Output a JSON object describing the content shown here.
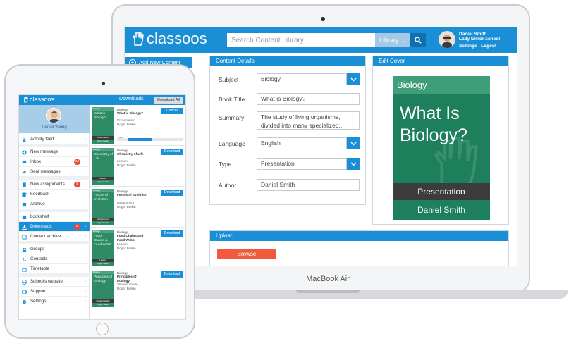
{
  "desktop": {
    "device_label": "MacBook Air",
    "header": {
      "logo": "classoos",
      "search_placeholder": "Search Content Library",
      "library_label": "Library",
      "user_name": "Daniel Smith",
      "user_school": "Lady Elinor school",
      "settings_label": "Settings",
      "links_separator": "|",
      "logout_label": "Logout"
    },
    "sidebar": {
      "add_new_content": "Add New Content"
    },
    "content_details": {
      "title": "Content Details",
      "subject_label": "Subject",
      "subject_value": "Biology",
      "book_title_label": "Book Title",
      "book_title_value": "What is Biology?",
      "summary_label": "Summary",
      "summary_value": "The study of living organisms, divided into many specialized...",
      "language_label": "Language",
      "language_value": "English",
      "type_label": "Type",
      "type_value": "Presentation",
      "author_label": "Author",
      "author_value": "Daniel Smith"
    },
    "edit_cover": {
      "title": "Edit Cover",
      "subject": "Biology",
      "book_title": "What Is Biology?",
      "type": "Presentation",
      "author": "Daniel Smith"
    },
    "upload": {
      "title": "Upload",
      "browse_label": "Browse"
    }
  },
  "tablet": {
    "header": {
      "logo": "classoos",
      "downloads_label": "Downloads",
      "download_all_label": "Download All"
    },
    "profile": {
      "user_name": "Daniel Young"
    },
    "sidebar": {
      "activity_feed": "Activity feed",
      "new_message": "New message",
      "inbox": "Inbox",
      "inbox_count": "12",
      "sent_messages": "Sent messages",
      "new_assignments": "New assignments",
      "assignments_count": "4",
      "feedback": "Feedback",
      "archive": "Archive",
      "bookshelf": "bookshelf",
      "downloads": "Downloads",
      "downloads_count": "8",
      "content_archive": "Content archive",
      "groups": "Groups",
      "contacts": "Contacts",
      "timetable": "Timetable",
      "schools_website": "School's website",
      "support": "Support",
      "settings": "Settings"
    },
    "downloads": {
      "rows": [
        {
          "subject": "Biology",
          "title": "What is Biology?",
          "type": "Presentation",
          "author": "Roger Betkin",
          "button": "Cancel",
          "progress_label": "43%",
          "progress": 0.43,
          "thumb_subject": "Biology",
          "thumb_title": "What is Biology?",
          "thumb_type": "Presentation",
          "thumb_author": "Roger Betkin"
        },
        {
          "subject": "Biology",
          "title": "Chemistry of Life",
          "type": "Lesson",
          "author": "Roger Betkin",
          "button": "Download",
          "thumb_subject": "Biology",
          "thumb_title": "Chemistry of Life",
          "thumb_type": "Lesson",
          "thumb_author": "Roger Betkin"
        },
        {
          "subject": "Biology",
          "title": "Forces of Evolution",
          "type": "Assignment",
          "author": "Roger Betkin",
          "button": "Download",
          "thumb_subject": "Biology",
          "thumb_title": "Forces of Evolution",
          "thumb_type": "Assignment",
          "thumb_author": "Roger Betkin"
        },
        {
          "subject": "Biology",
          "title": "Food Chains and Food Webs",
          "type": "Lesson",
          "author": "Roger Betkin",
          "button": "Download",
          "thumb_subject": "Biology",
          "thumb_title": "Food Chains & Food Webs",
          "thumb_type": "Lesson",
          "thumb_author": "Roger Betkin"
        },
        {
          "subject": "Biology",
          "title": "Principles of Ecology",
          "type": "Student Guide",
          "author": "Roger Betkin",
          "button": "Download",
          "thumb_subject": "Biology",
          "thumb_title": "Principles of Ecology",
          "thumb_type": "Student Guide",
          "thumb_author": "Roger Betkin"
        }
      ]
    }
  },
  "colors": {
    "brand_blue": "#1b8fd6",
    "cover_green": "#1d7f5b",
    "browse_orange": "#f15a3c",
    "badge_red": "#e74c3c"
  }
}
